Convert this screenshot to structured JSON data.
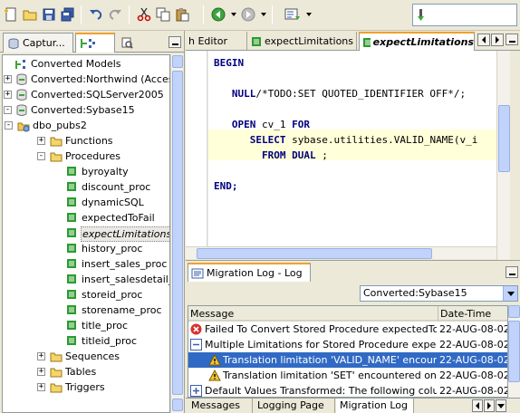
{
  "search": {
    "value": ""
  },
  "left_panel": {
    "tabs": [
      {
        "label": "Captur..."
      },
      {
        "label": ""
      },
      {
        "label": ""
      }
    ]
  },
  "tree": {
    "items": [
      {
        "label": "Converted Models",
        "icon": "models-icon"
      },
      {
        "label": "Converted:Northwind (Access",
        "icon": "connection-icon"
      },
      {
        "label": "Converted:SQLServer2005",
        "icon": "connection-icon"
      },
      {
        "label": "Converted:Sybase15",
        "icon": "connection-icon"
      },
      {
        "label": "dbo_pubs2",
        "icon": "schema-icon"
      },
      {
        "label": "Functions",
        "icon": "folder-icon"
      },
      {
        "label": "Procedures",
        "icon": "folder-icon"
      },
      {
        "label": "byroyalty",
        "icon": "procedure-icon"
      },
      {
        "label": "discount_proc",
        "icon": "procedure-icon"
      },
      {
        "label": "dynamicSQL",
        "icon": "procedure-icon"
      },
      {
        "label": "expectedToFail",
        "icon": "procedure-icon"
      },
      {
        "label": "expectLimitations",
        "icon": "procedure-icon",
        "selected": true
      },
      {
        "label": "history_proc",
        "icon": "procedure-icon"
      },
      {
        "label": "insert_sales_proc",
        "icon": "procedure-icon"
      },
      {
        "label": "insert_salesdetail_",
        "icon": "procedure-icon"
      },
      {
        "label": "storeid_proc",
        "icon": "procedure-icon"
      },
      {
        "label": "storename_proc",
        "icon": "procedure-icon"
      },
      {
        "label": "title_proc",
        "icon": "procedure-icon"
      },
      {
        "label": "titleid_proc",
        "icon": "procedure-icon"
      },
      {
        "label": "Sequences",
        "icon": "folder-icon"
      },
      {
        "label": "Tables",
        "icon": "folder-icon"
      },
      {
        "label": "Triggers",
        "icon": "folder-icon"
      }
    ]
  },
  "editor": {
    "tabs": [
      {
        "label": "h Editor"
      },
      {
        "label": "expectLimitations"
      },
      {
        "label": "expectLimitations",
        "active": true
      }
    ],
    "code": [
      {
        "text": "BEGIN"
      },
      {
        "text": ""
      },
      {
        "text": "   NULL/*TODO:SET QUOTED_IDENTIFIER OFF*/;"
      },
      {
        "text": ""
      },
      {
        "text": "   OPEN cv_1 FOR"
      },
      {
        "text": "      SELECT sybase.utilities.VALID_NAME(v_i"
      },
      {
        "text": "        FROM DUAL ;"
      },
      {
        "text": ""
      },
      {
        "text": "END;"
      }
    ]
  },
  "log": {
    "tab_label": "Migration Log - Log",
    "selected_model": "Converted:Sybase15",
    "columns": [
      "Message",
      "Date-Time"
    ],
    "rows": [
      {
        "icon": "error-icon",
        "message": "Failed To Convert Stored Procedure expectedToFail",
        "date": "22-AUG-08-02:"
      },
      {
        "icon": "collapse-icon",
        "message": "Multiple Limitations for Stored Procedure expectLimitat",
        "date": "22-AUG-08-02:"
      },
      {
        "icon": "warning-icon",
        "message": "Translation limitation 'VALID_NAME' encountered",
        "date": "22-AUG-08-02:",
        "selected": true
      },
      {
        "icon": "warning-icon",
        "message": "Translation limitation 'SET' encountered on Stored",
        "date": "22-AUG-08-02:"
      },
      {
        "icon": "expand-icon",
        "message": "Default Values Transformed: The following column de",
        "date": "22-AUG-08-02:"
      }
    ],
    "bottom_tabs": [
      {
        "label": "Messages"
      },
      {
        "label": "Logging Page"
      },
      {
        "label": "Migration Log",
        "active": true
      }
    ]
  }
}
